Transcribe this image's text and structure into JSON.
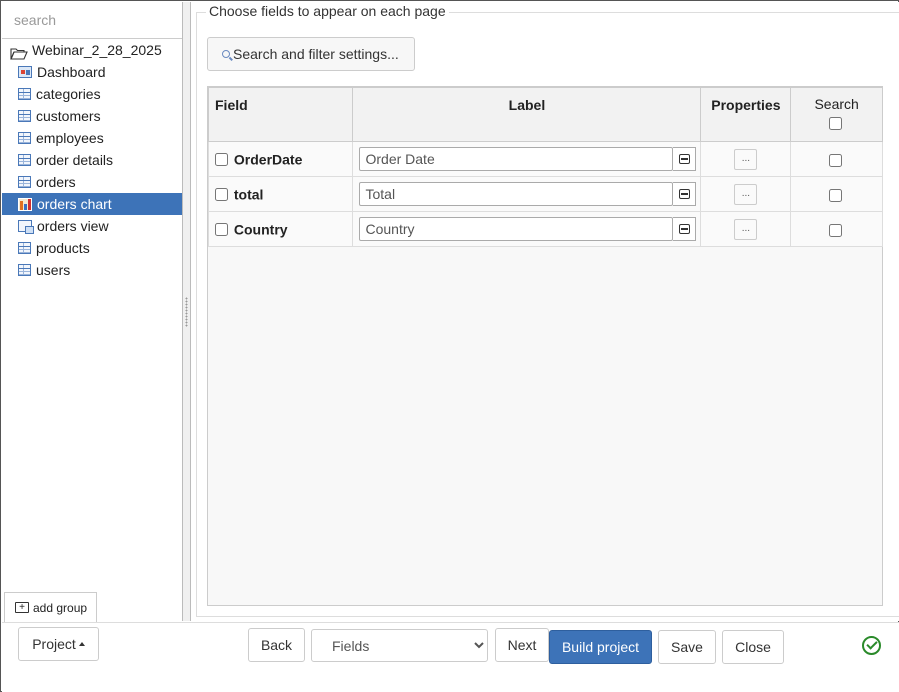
{
  "sidebar": {
    "search_placeholder": "search",
    "project_name": "Webinar_2_28_2025",
    "items": [
      {
        "label": "Dashboard",
        "icon": "dashboard-icon"
      },
      {
        "label": "categories",
        "icon": "table-icon"
      },
      {
        "label": "customers",
        "icon": "table-icon"
      },
      {
        "label": "employees",
        "icon": "table-icon"
      },
      {
        "label": "order details",
        "icon": "table-icon"
      },
      {
        "label": "orders",
        "icon": "table-icon"
      },
      {
        "label": "orders chart",
        "icon": "chart-icon",
        "selected": true
      },
      {
        "label": "orders view",
        "icon": "view-icon"
      },
      {
        "label": "products",
        "icon": "table-icon"
      },
      {
        "label": "users",
        "icon": "table-icon"
      }
    ],
    "add_group_label": "add group"
  },
  "main": {
    "legend": "Choose fields to appear on each page",
    "filter_button_label": "Search and filter settings...",
    "columns": {
      "field": "Field",
      "label": "Label",
      "properties": "Properties",
      "search": "Search"
    },
    "rows": [
      {
        "field": "OrderDate",
        "label": "Order Date",
        "props": "..."
      },
      {
        "field": "total",
        "label": "Total",
        "props": "..."
      },
      {
        "field": "Country",
        "label": "Country",
        "props": "..."
      }
    ]
  },
  "bottom": {
    "project_label": "Project",
    "back_label": "Back",
    "step_select_value": "Fields",
    "next_label": "Next",
    "build_label": "Build project",
    "save_label": "Save",
    "close_label": "Close",
    "status_icon": "check-circle-icon"
  },
  "colors": {
    "accent": "#3d73b8",
    "success": "#2a8a2a"
  }
}
